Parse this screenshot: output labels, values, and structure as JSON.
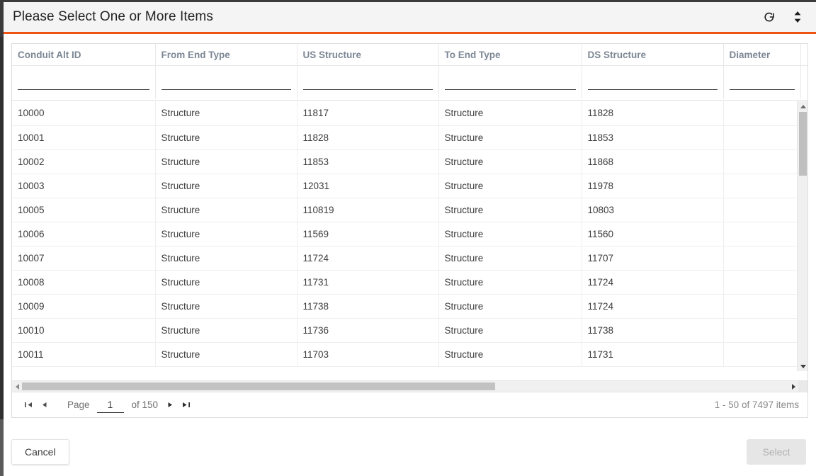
{
  "dialog": {
    "title": "Please Select One or More Items",
    "accent_color": "#ef5412",
    "header_bg": "#f4f4f4",
    "refresh_icon": "refresh-icon",
    "resize_icon": "expand-collapse-icon"
  },
  "grid": {
    "columns": [
      {
        "label": "Conduit Alt ID",
        "filter_value": "",
        "filter_placeholder": ""
      },
      {
        "label": "From End Type",
        "filter_value": "",
        "filter_placeholder": ""
      },
      {
        "label": "US Structure",
        "filter_value": "",
        "filter_placeholder": ""
      },
      {
        "label": "To End Type",
        "filter_value": "",
        "filter_placeholder": ""
      },
      {
        "label": "DS Structure",
        "filter_value": "",
        "filter_placeholder": ""
      },
      {
        "label": "Diameter",
        "filter_value": "",
        "filter_placeholder": ""
      }
    ],
    "rows": [
      {
        "conduit_alt_id": "10000",
        "from_end_type": "Structure",
        "us_structure": "11817",
        "to_end_type": "Structure",
        "ds_structure": "11828",
        "diameter": ""
      },
      {
        "conduit_alt_id": "10001",
        "from_end_type": "Structure",
        "us_structure": "11828",
        "to_end_type": "Structure",
        "ds_structure": "11853",
        "diameter": ""
      },
      {
        "conduit_alt_id": "10002",
        "from_end_type": "Structure",
        "us_structure": "11853",
        "to_end_type": "Structure",
        "ds_structure": "11868",
        "diameter": ""
      },
      {
        "conduit_alt_id": "10003",
        "from_end_type": "Structure",
        "us_structure": "12031",
        "to_end_type": "Structure",
        "ds_structure": "11978",
        "diameter": ""
      },
      {
        "conduit_alt_id": "10005",
        "from_end_type": "Structure",
        "us_structure": "110819",
        "to_end_type": "Structure",
        "ds_structure": "10803",
        "diameter": ""
      },
      {
        "conduit_alt_id": "10006",
        "from_end_type": "Structure",
        "us_structure": "11569",
        "to_end_type": "Structure",
        "ds_structure": "11560",
        "diameter": ""
      },
      {
        "conduit_alt_id": "10007",
        "from_end_type": "Structure",
        "us_structure": "11724",
        "to_end_type": "Structure",
        "ds_structure": "11707",
        "diameter": ""
      },
      {
        "conduit_alt_id": "10008",
        "from_end_type": "Structure",
        "us_structure": "11731",
        "to_end_type": "Structure",
        "ds_structure": "11724",
        "diameter": ""
      },
      {
        "conduit_alt_id": "10009",
        "from_end_type": "Structure",
        "us_structure": "11738",
        "to_end_type": "Structure",
        "ds_structure": "11724",
        "diameter": ""
      },
      {
        "conduit_alt_id": "10010",
        "from_end_type": "Structure",
        "us_structure": "11736",
        "to_end_type": "Structure",
        "ds_structure": "11738",
        "diameter": ""
      },
      {
        "conduit_alt_id": "10011",
        "from_end_type": "Structure",
        "us_structure": "11703",
        "to_end_type": "Structure",
        "ds_structure": "11731",
        "diameter": ""
      }
    ]
  },
  "pager": {
    "first_icon": "first-page-icon",
    "prev_icon": "previous-page-icon",
    "page_label": "Page",
    "page_value": "1",
    "of_label": "of 150",
    "next_icon": "next-page-icon",
    "last_icon": "last-page-icon",
    "item_range": "1 - 50 of 7497 items"
  },
  "footer": {
    "cancel_label": "Cancel",
    "select_label": "Select"
  }
}
